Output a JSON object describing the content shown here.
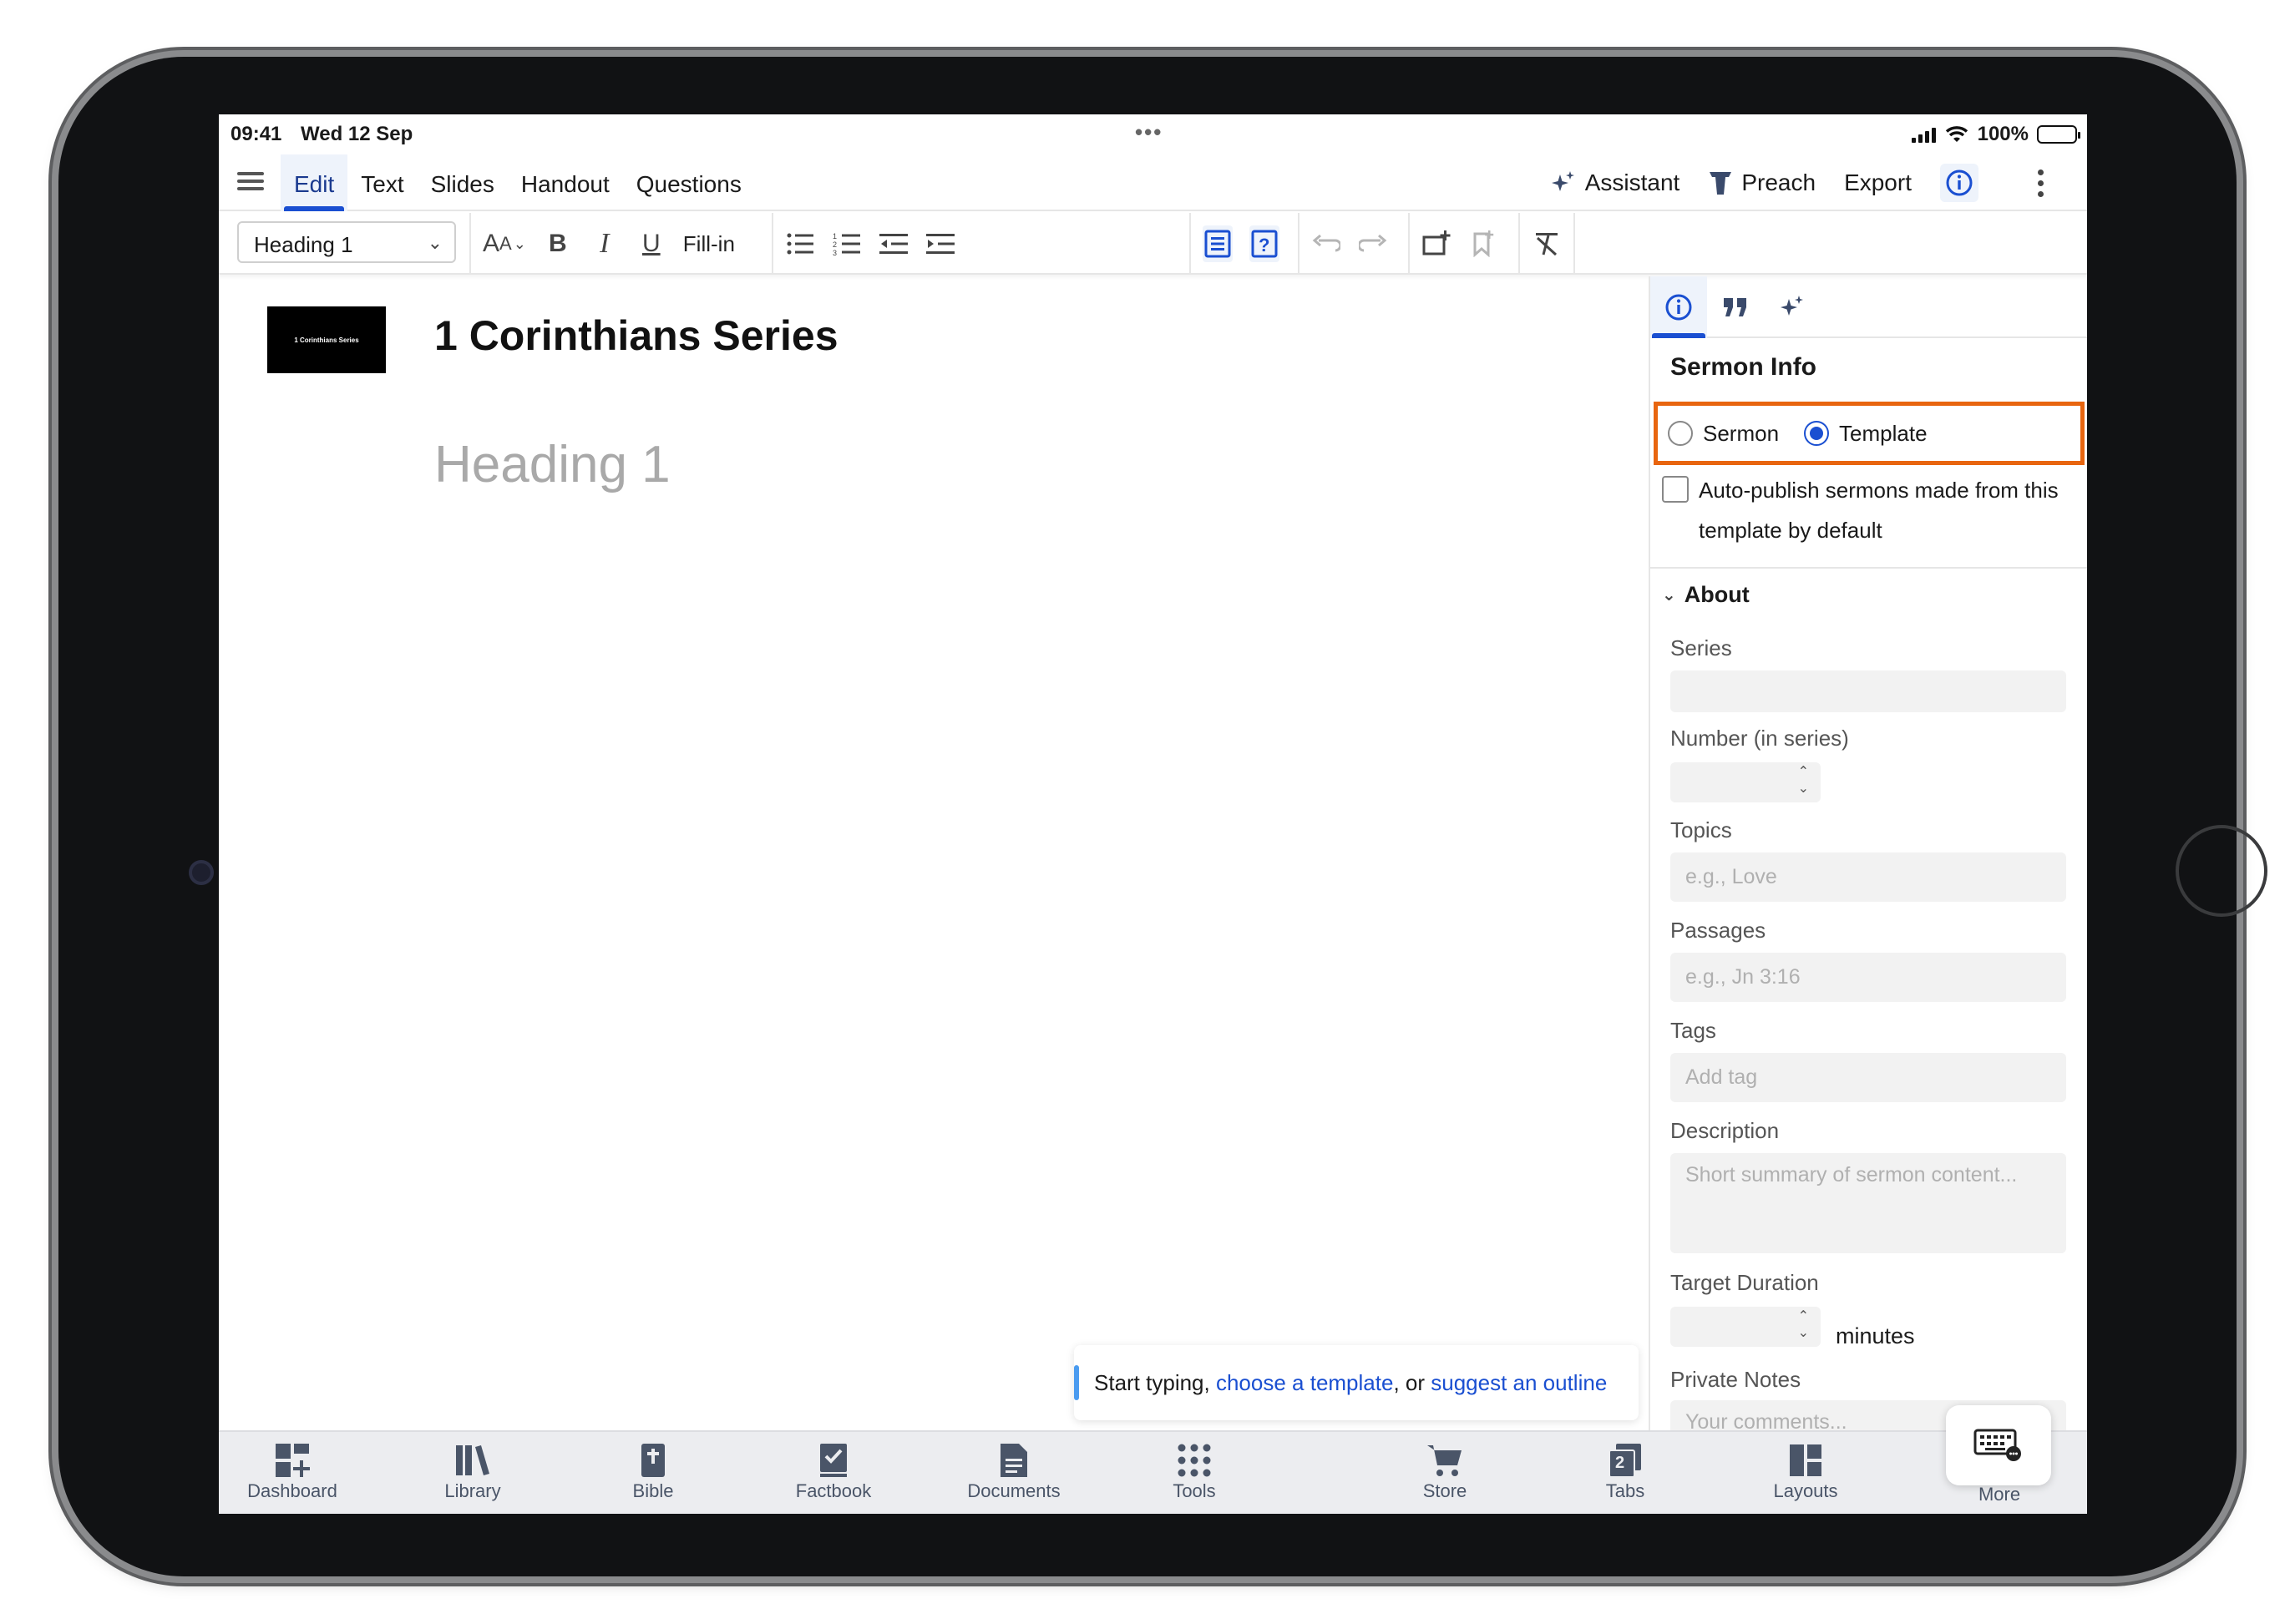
{
  "status_bar": {
    "time": "09:41",
    "date": "Wed 12 Sep",
    "battery": "100%"
  },
  "top_nav": {
    "tabs": [
      "Edit",
      "Text",
      "Slides",
      "Handout",
      "Questions"
    ],
    "active_tab": "Edit",
    "assistant": "Assistant",
    "preach": "Preach",
    "export": "Export"
  },
  "toolbar": {
    "style_select": "Heading 1",
    "fill_in": "Fill-in"
  },
  "editor": {
    "thumbnail_text": "1 Corinthians Series",
    "title": "1 Corinthians Series",
    "heading_placeholder": "Heading 1",
    "hint_prefix": "Start typing, ",
    "hint_link1": "choose a template",
    "hint_middle": ", or ",
    "hint_link2": "suggest an outline"
  },
  "panel": {
    "title": "Sermon Info",
    "type_sermon": "Sermon",
    "type_template": "Template",
    "selected_type": "Template",
    "autopublish": "Auto-publish sermons made from this template by default",
    "autopublish_checked": false,
    "about": "About",
    "series_label": "Series",
    "number_label": "Number (in series)",
    "topics_label": "Topics",
    "topics_placeholder": "e.g., Love",
    "passages_label": "Passages",
    "passages_placeholder": "e.g., Jn 3:16",
    "tags_label": "Tags",
    "tags_placeholder": "Add tag",
    "description_label": "Description",
    "description_placeholder": "Short summary of sermon content...",
    "duration_label": "Target Duration",
    "minutes": "minutes",
    "notes_label": "Private Notes",
    "notes_placeholder": "Your comments..."
  },
  "bottom_bar": {
    "items": [
      "Dashboard",
      "Library",
      "Bible",
      "Factbook",
      "Documents",
      "Tools",
      "Store",
      "Tabs",
      "Layouts",
      "More"
    ],
    "tabs_count": "2"
  },
  "colors": {
    "accent": "#1a4fd1",
    "highlight_border": "#e8650f",
    "bottom_bar_bg": "#ecedf0"
  }
}
